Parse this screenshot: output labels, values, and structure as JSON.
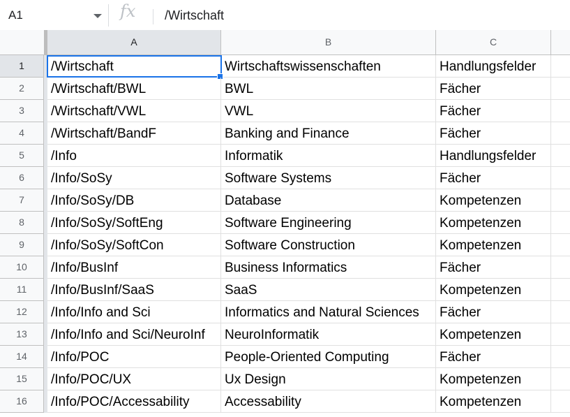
{
  "formula_bar": {
    "name_box": "A1",
    "fx_symbol": "fx",
    "formula": "/Wirtschaft"
  },
  "column_headers": [
    "A",
    "B",
    "C"
  ],
  "rows": [
    {
      "num": "1",
      "a": "/Wirtschaft",
      "b": "Wirtschaftswissenschaften",
      "c": "Handlungsfelder"
    },
    {
      "num": "2",
      "a": "/Wirtschaft/BWL",
      "b": "BWL",
      "c": "Fächer"
    },
    {
      "num": "3",
      "a": "/Wirtschaft/VWL",
      "b": "VWL",
      "c": "Fächer"
    },
    {
      "num": "4",
      "a": "/Wirtschaft/BandF",
      "b": "Banking and Finance",
      "c": "Fächer"
    },
    {
      "num": "5",
      "a": "/Info",
      "b": "Informatik",
      "c": "Handlungsfelder"
    },
    {
      "num": "6",
      "a": "/Info/SoSy",
      "b": "Software Systems",
      "c": "Fächer"
    },
    {
      "num": "7",
      "a": "/Info/SoSy/DB",
      "b": "Database",
      "c": "Kompetenzen"
    },
    {
      "num": "8",
      "a": "/Info/SoSy/SoftEng",
      "b": "Software Engineering",
      "c": "Kompetenzen"
    },
    {
      "num": "9",
      "a": "/Info/SoSy/SoftCon",
      "b": "Software Construction",
      "c": "Kompetenzen"
    },
    {
      "num": "10",
      "a": "/Info/BusInf",
      "b": "Business Informatics",
      "c": "Fächer"
    },
    {
      "num": "11",
      "a": "/Info/BusInf/SaaS",
      "b": "SaaS",
      "c": "Kompetenzen"
    },
    {
      "num": "12",
      "a": "/Info/Info and Sci",
      "b": "Informatics and Natural Sciences",
      "c": "Fächer"
    },
    {
      "num": "13",
      "a": "/Info/Info and Sci/NeuroInf",
      "b": "NeuroInformatik",
      "c": "Kompetenzen"
    },
    {
      "num": "14",
      "a": "/Info/POC",
      "b": "People-Oriented Computing",
      "c": "Fächer"
    },
    {
      "num": "15",
      "a": "/Info/POC/UX",
      "b": "Ux Design",
      "c": "Kompetenzen"
    },
    {
      "num": "16",
      "a": "/Info/POC/Accessability",
      "b": "Accessability",
      "c": "Kompetenzen"
    }
  ],
  "colors": {
    "selection": "#1a73e8",
    "header_bg": "#f8f9fa",
    "header_selected_bg": "#e2e5e9"
  }
}
